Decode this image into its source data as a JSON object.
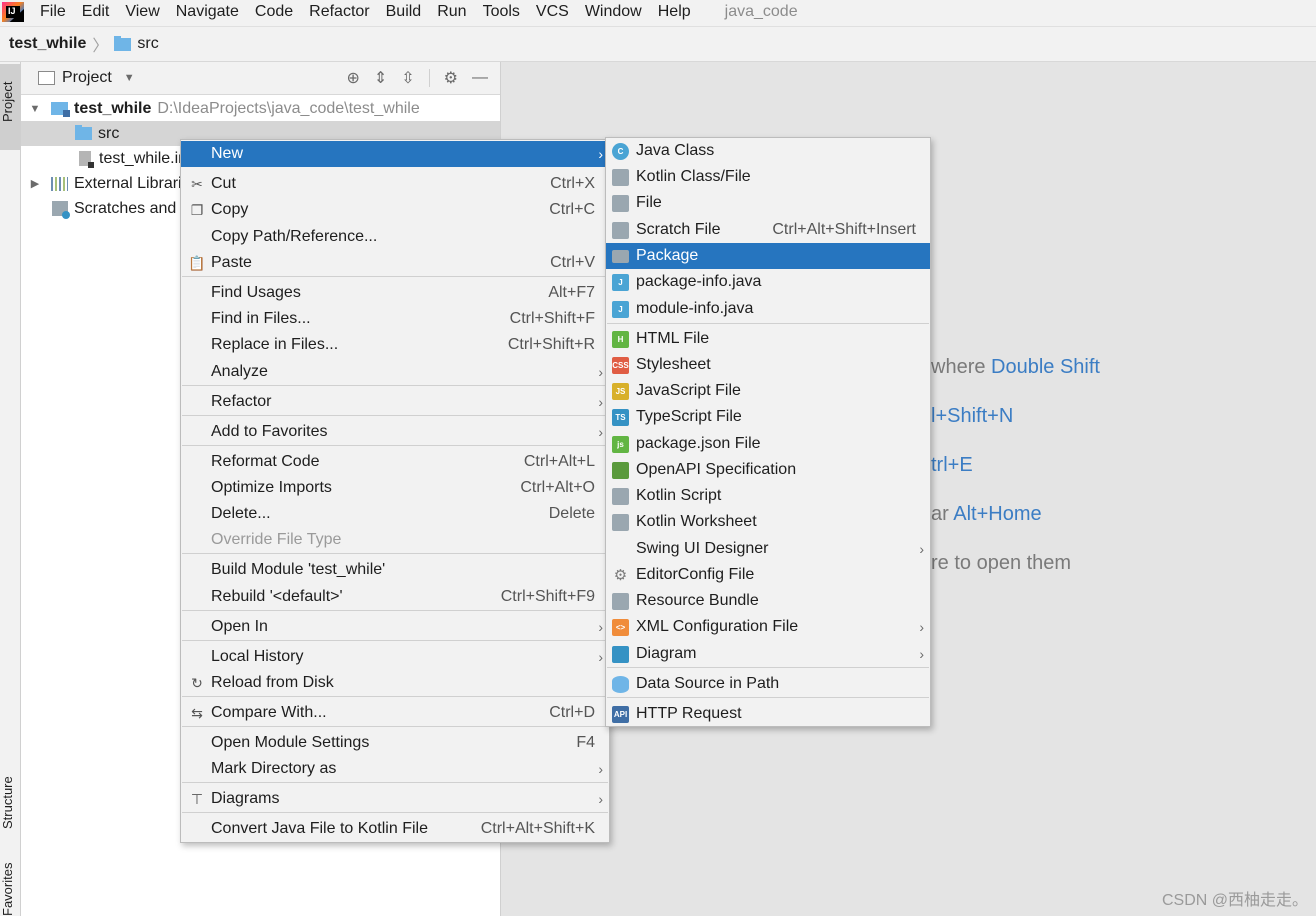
{
  "menubar": {
    "items": [
      "File",
      "Edit",
      "View",
      "Navigate",
      "Code",
      "Refactor",
      "Build",
      "Run",
      "Tools",
      "VCS",
      "Window",
      "Help"
    ],
    "project_name": "java_code"
  },
  "breadcrumb": {
    "project": "test_while",
    "folder": "src"
  },
  "left_strip": {
    "project_tab": "Project",
    "structure_tab": "Structure",
    "favorites_tab": "Favorites"
  },
  "project_panel": {
    "title": "Project",
    "tree": {
      "root_name": "test_while",
      "root_path": "D:\\IdeaProjects\\java_code\\test_while",
      "src": "src",
      "iml": "test_while.iml",
      "external_libraries": "External Libraries",
      "scratches": "Scratches and Consoles"
    }
  },
  "editor_hints": {
    "line1": "where ",
    "line1_key": "Double Shift",
    "line2_key": "l+Shift+N",
    "line3_key": "trl+E",
    "line4": "ar ",
    "line4_key": "Alt+Home",
    "line5": "re to open them"
  },
  "watermark": "CSDN @西柚走走。",
  "context_menu": {
    "items": [
      {
        "label": "New",
        "shortcut": "",
        "submenu": true,
        "icon": ""
      },
      {
        "label": "Cut",
        "shortcut": "Ctrl+X",
        "icon": "cut-icon"
      },
      {
        "label": "Copy",
        "shortcut": "Ctrl+C",
        "icon": "copy-icon"
      },
      {
        "label": "Copy Path/Reference...",
        "shortcut": "",
        "icon": ""
      },
      {
        "label": "Paste",
        "shortcut": "Ctrl+V",
        "icon": "paste-icon"
      },
      {
        "label": "Find Usages",
        "shortcut": "Alt+F7",
        "icon": ""
      },
      {
        "label": "Find in Files...",
        "shortcut": "Ctrl+Shift+F",
        "icon": ""
      },
      {
        "label": "Replace in Files...",
        "shortcut": "Ctrl+Shift+R",
        "icon": ""
      },
      {
        "label": "Analyze",
        "shortcut": "",
        "submenu": true,
        "icon": ""
      },
      {
        "label": "Refactor",
        "shortcut": "",
        "submenu": true,
        "icon": ""
      },
      {
        "label": "Add to Favorites",
        "shortcut": "",
        "submenu": true,
        "icon": ""
      },
      {
        "label": "Reformat Code",
        "shortcut": "Ctrl+Alt+L",
        "icon": ""
      },
      {
        "label": "Optimize Imports",
        "shortcut": "Ctrl+Alt+O",
        "icon": ""
      },
      {
        "label": "Delete...",
        "shortcut": "Delete",
        "icon": ""
      },
      {
        "label": "Override File Type",
        "shortcut": "",
        "disabled": true,
        "icon": ""
      },
      {
        "label": "Build Module 'test_while'",
        "shortcut": "",
        "icon": ""
      },
      {
        "label": "Rebuild '<default>'",
        "shortcut": "Ctrl+Shift+F9",
        "icon": ""
      },
      {
        "label": "Open In",
        "shortcut": "",
        "submenu": true,
        "icon": ""
      },
      {
        "label": "Local History",
        "shortcut": "",
        "submenu": true,
        "icon": ""
      },
      {
        "label": "Reload from Disk",
        "shortcut": "",
        "icon": "reload-icon"
      },
      {
        "label": "Compare With...",
        "shortcut": "Ctrl+D",
        "icon": "compare-icon"
      },
      {
        "label": "Open Module Settings",
        "shortcut": "F4",
        "icon": ""
      },
      {
        "label": "Mark Directory as",
        "shortcut": "",
        "submenu": true,
        "icon": ""
      },
      {
        "label": "Diagrams",
        "shortcut": "",
        "submenu": true,
        "icon": "diagram-icon"
      },
      {
        "label": "Convert Java File to Kotlin File",
        "shortcut": "Ctrl+Alt+Shift+K",
        "icon": ""
      }
    ]
  },
  "submenu": {
    "items": [
      {
        "label": "Java Class",
        "shortcut": "",
        "icon": "java-class-icon",
        "badge": "C",
        "color": "#4aa4d4"
      },
      {
        "label": "Kotlin Class/File",
        "shortcut": "",
        "icon": "kotlin-file-icon",
        "badge": "",
        "color": "#9aa7b0"
      },
      {
        "label": "File",
        "shortcut": "",
        "icon": "file-icon",
        "badge": "",
        "color": "#9aa7b0"
      },
      {
        "label": "Scratch File",
        "shortcut": "Ctrl+Alt+Shift+Insert",
        "icon": "scratch-file-icon",
        "badge": "",
        "color": "#9aa7b0"
      },
      {
        "label": "Package",
        "shortcut": "",
        "icon": "package-icon",
        "badge": "",
        "color": "#9aa7b0"
      },
      {
        "label": "package-info.java",
        "shortcut": "",
        "icon": "package-info-icon",
        "badge": "J",
        "color": "#4aa4d4"
      },
      {
        "label": "module-info.java",
        "shortcut": "",
        "icon": "module-info-icon",
        "badge": "J",
        "color": "#4aa4d4"
      },
      {
        "label": "HTML File",
        "shortcut": "",
        "icon": "html-file-icon",
        "badge": "H",
        "color": "#62b543"
      },
      {
        "label": "Stylesheet",
        "shortcut": "",
        "icon": "css-file-icon",
        "badge": "CSS",
        "color": "#e05d44"
      },
      {
        "label": "JavaScript File",
        "shortcut": "",
        "icon": "js-file-icon",
        "badge": "JS",
        "color": "#d8b02a"
      },
      {
        "label": "TypeScript File",
        "shortcut": "",
        "icon": "ts-file-icon",
        "badge": "TS",
        "color": "#3592c4"
      },
      {
        "label": "package.json File",
        "shortcut": "",
        "icon": "node-json-icon",
        "badge": "js",
        "color": "#62b543"
      },
      {
        "label": "OpenAPI Specification",
        "shortcut": "",
        "icon": "openapi-icon",
        "badge": "",
        "color": "#5a9a3c"
      },
      {
        "label": "Kotlin Script",
        "shortcut": "",
        "icon": "kotlin-script-icon",
        "badge": "",
        "color": "#9aa7b0"
      },
      {
        "label": "Kotlin Worksheet",
        "shortcut": "",
        "icon": "kotlin-worksheet-icon",
        "badge": "",
        "color": "#9aa7b0"
      },
      {
        "label": "Swing UI Designer",
        "shortcut": "",
        "submenu": true,
        "icon": "",
        "badge": "",
        "color": ""
      },
      {
        "label": "EditorConfig File",
        "shortcut": "",
        "icon": "gear-icon",
        "badge": "",
        "color": "#9aa7b0"
      },
      {
        "label": "Resource Bundle",
        "shortcut": "",
        "icon": "resource-bundle-icon",
        "badge": "",
        "color": "#9aa7b0"
      },
      {
        "label": "XML Configuration File",
        "shortcut": "",
        "submenu": true,
        "icon": "xml-file-icon",
        "badge": "<>",
        "color": "#f08c3a"
      },
      {
        "label": "Diagram",
        "shortcut": "",
        "submenu": true,
        "icon": "diagram-icon",
        "badge": "",
        "color": "#3592c4"
      },
      {
        "label": "Data Source in Path",
        "shortcut": "",
        "icon": "database-icon",
        "badge": "",
        "color": "#6fb5e7"
      },
      {
        "label": "HTTP Request",
        "shortcut": "",
        "icon": "api-icon",
        "badge": "API",
        "color": "#3f6ea5"
      }
    ]
  }
}
